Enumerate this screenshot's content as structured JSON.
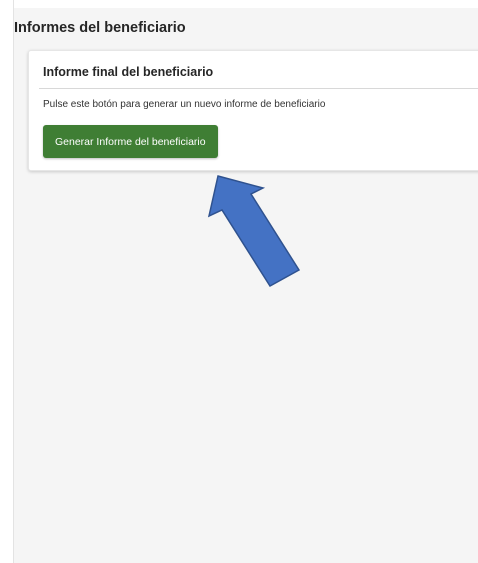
{
  "section": {
    "title": "Informes del beneficiario"
  },
  "card": {
    "title": "Informe final del beneficiario",
    "description": "Pulse este botón para generar un nuevo informe de beneficiario",
    "button_label": "Generar Informe del beneficiario"
  },
  "annotation": {
    "icon": "pointer-arrow-icon",
    "color": "#4472c4",
    "stroke_color": "#2f528f"
  },
  "colors": {
    "button": "#3f7e34",
    "background": "#f5f5f5"
  }
}
